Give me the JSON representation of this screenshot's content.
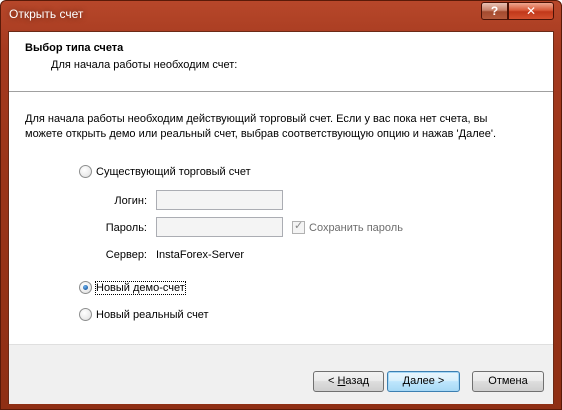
{
  "window": {
    "title": "Открыть счет",
    "help_label": "?",
    "close_label": "✕"
  },
  "header": {
    "title": "Выбор типа счета",
    "subtitle": "Для начала работы необходим счет:"
  },
  "intro": "Для начала работы необходим действующий торговый счет. Если у вас пока нет счета, вы можете открыть демо или реальный счет, выбрав соответствующую опцию и нажав 'Далее'.",
  "options": {
    "existing": {
      "label": "Существующий торговый счет",
      "checked": false
    },
    "demo": {
      "label": "Новый демо-счет",
      "checked": true
    },
    "real": {
      "label": "Новый реальный счет",
      "checked": false
    }
  },
  "fields": {
    "login_label": "Логин:",
    "login_value": "",
    "password_label": "Пароль:",
    "password_value": "",
    "save_password_label": "Сохранить пароль",
    "save_password_checked": true,
    "server_label": "Сервер:",
    "server_value": "InstaForex-Server"
  },
  "buttons": {
    "back_prefix": "< ",
    "back_mnemonic": "Н",
    "back_rest": "азад",
    "next_mnemonic": "Д",
    "next_rest": "алее >",
    "cancel": "Отмена"
  }
}
